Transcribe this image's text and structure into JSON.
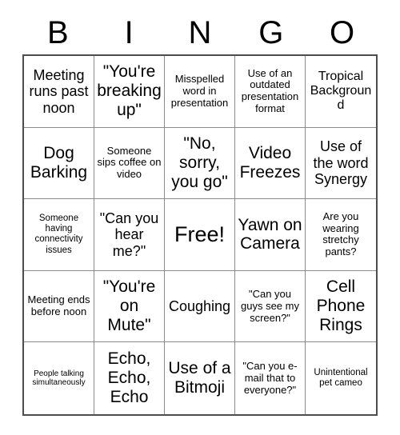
{
  "header": {
    "letters": [
      "B",
      "I",
      "N",
      "G",
      "O"
    ]
  },
  "colors": {
    "background": "#ffffff",
    "text": "#000000",
    "outer_border": "#4d4d4d",
    "inner_grid_line": "#8c8c8c"
  },
  "grid": {
    "columns": 5,
    "rows": 5,
    "free_space_index": 12,
    "cells": [
      {
        "text": "Meeting runs past noon",
        "size": "lg"
      },
      {
        "text": "\"You're breaking up\"",
        "size": "xl"
      },
      {
        "text": "Misspelled word in presentation",
        "size": "sm"
      },
      {
        "text": "Use of an outdated presentation format",
        "size": "sm"
      },
      {
        "text": "Tropical Background",
        "size": "md"
      },
      {
        "text": "Dog Barking",
        "size": "xl"
      },
      {
        "text": "Someone sips coffee on video",
        "size": "sm"
      },
      {
        "text": "\"No, sorry, you go\"",
        "size": "xl"
      },
      {
        "text": "Video Freezes",
        "size": "xl"
      },
      {
        "text": "Use of the word Synergy",
        "size": "lg"
      },
      {
        "text": "Someone having connectivity issues",
        "size": "xs"
      },
      {
        "text": "\"Can you hear me?\"",
        "size": "lg"
      },
      {
        "text": "Free!",
        "size": "xxl"
      },
      {
        "text": "Yawn on Camera",
        "size": "xl"
      },
      {
        "text": "Are you wearing stretchy pants?",
        "size": "sm"
      },
      {
        "text": "Meeting ends before noon",
        "size": "sm"
      },
      {
        "text": "\"You're on Mute\"",
        "size": "xl"
      },
      {
        "text": "Coughing",
        "size": "lg"
      },
      {
        "text": "\"Can you guys see my screen?\"",
        "size": "sm"
      },
      {
        "text": "Cell Phone Rings",
        "size": "xl"
      },
      {
        "text": "People talking simultaneously",
        "size": "xxs"
      },
      {
        "text": "Echo, Echo, Echo",
        "size": "xl"
      },
      {
        "text": "Use of a Bitmoji",
        "size": "xl"
      },
      {
        "text": "\"Can you e-mail that to everyone?\"",
        "size": "sm"
      },
      {
        "text": "Unintentional pet cameo",
        "size": "xs"
      }
    ]
  }
}
